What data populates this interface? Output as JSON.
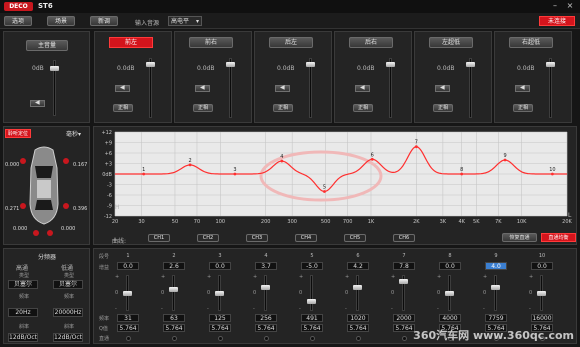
{
  "window": {
    "logo_text": "DECO",
    "model": "ST6",
    "connect_label": "未连接"
  },
  "toolbar": {
    "buttons": [
      "选项",
      "场景",
      "新调"
    ],
    "input_source_label": "输入音源",
    "input_source_value": "高电平"
  },
  "master": {
    "title": "主音量",
    "value": "0dB"
  },
  "channels": [
    {
      "name": "前左",
      "value": "0.0dB",
      "positive": "正相",
      "selected": true
    },
    {
      "name": "前右",
      "value": "0.0dB",
      "positive": "正相",
      "selected": false
    },
    {
      "name": "后左",
      "value": "0.0dB",
      "positive": "正相",
      "selected": false
    },
    {
      "name": "后右",
      "value": "0.0dB",
      "positive": "正相",
      "selected": false
    },
    {
      "name": "左超低",
      "value": "0.0dB",
      "positive": "正相",
      "selected": false
    },
    {
      "name": "右超低",
      "value": "0.0dB",
      "positive": "正相",
      "selected": false
    }
  ],
  "position": {
    "title": "聆听定位",
    "unit": "毫秒",
    "values": {
      "fl": "0.000",
      "fr": "0.167",
      "rl": "0.271",
      "rr": "0.396",
      "bl": "0.000",
      "br": "0.000"
    }
  },
  "eq_graph": {
    "y_labels": [
      "+12",
      "+9",
      "+6",
      "+3",
      "0dB",
      "-3",
      "-6",
      "-9",
      "-12"
    ],
    "x_labels": [
      "20",
      "30",
      "50",
      "70",
      "100",
      "200",
      "300",
      "500",
      "700",
      "1K",
      "2K",
      "3K",
      "4K",
      "5K",
      "7K",
      "10K",
      "20K"
    ],
    "h_label": "H",
    "l_label": "L",
    "curve_label": "曲线: ",
    "ch_buttons": [
      "CH1",
      "CH2",
      "CH3",
      "CH4",
      "CH5",
      "CH6"
    ],
    "reset_label": "恢复直通",
    "bypass_label": "直通均衡",
    "markers": [
      "1",
      "2",
      "3",
      "4",
      "5",
      "6",
      "7",
      "8",
      "9",
      "10"
    ]
  },
  "crossover": {
    "title": "分频器",
    "hp_label": "高通",
    "lp_label": "低通",
    "type_label": "类型",
    "hp_type": "贝塞尔",
    "lp_type": "贝塞尔",
    "freq_label": "频率",
    "hp_freq": "20Hz",
    "lp_freq": "20000Hz",
    "slope_label": "斜率",
    "hp_slope": "12dB/Oct",
    "lp_slope": "12dB/Oct"
  },
  "eq_bands": {
    "row_labels": {
      "index": "段号",
      "gain": "增益",
      "freq": "频率",
      "q": "Q值",
      "bypass": "直通"
    },
    "bands": [
      {
        "n": "1",
        "gain": "0.0",
        "freq": "31",
        "q": "5.764"
      },
      {
        "n": "2",
        "gain": "2.6",
        "freq": "63",
        "q": "5.764"
      },
      {
        "n": "3",
        "gain": "0.0",
        "freq": "125",
        "q": "5.764"
      },
      {
        "n": "4",
        "gain": "3.7",
        "freq": "256",
        "q": "5.764"
      },
      {
        "n": "5",
        "gain": "-5.0",
        "freq": "491",
        "q": "5.764"
      },
      {
        "n": "6",
        "gain": "4.2",
        "freq": "1020",
        "q": "5.764"
      },
      {
        "n": "7",
        "gain": "7.8",
        "freq": "2000",
        "q": "5.764"
      },
      {
        "n": "8",
        "gain": "0.0",
        "freq": "4000",
        "q": "5.764"
      },
      {
        "n": "9",
        "gain": "4.0",
        "freq": "7759",
        "q": "5.764"
      },
      {
        "n": "10",
        "gain": "0.0",
        "freq": "16000",
        "q": "5.764"
      }
    ]
  },
  "watermark": "360汽车网 www.360qc.com",
  "colors": {
    "accent": "#d4141c",
    "curve": "#ff2f2f",
    "panel": "#242424"
  }
}
